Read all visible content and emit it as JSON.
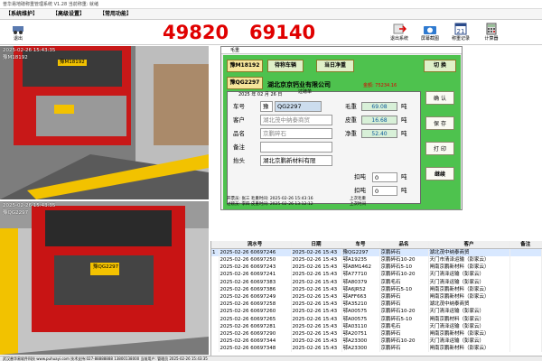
{
  "window_title": "普华易地磅称重管理系统 V1.28   当前称重: 就绪",
  "menu": [
    "系统维护",
    "高级设置",
    "常用功能"
  ],
  "toolbar": {
    "left_btn": "退出",
    "right_btns": [
      "退出系统",
      "屏幕截图",
      "称重记录",
      "计算器"
    ],
    "weight1": "49820",
    "weight2": "69140"
  },
  "camera1": {
    "timestamp": "2025-02-26  15:43:35",
    "plate_text": "豫M18192",
    "plate": "豫M18192"
  },
  "camera2": {
    "timestamp": "2025-02-26  15:43:35",
    "plate_text": "豫QG2297",
    "plate": "豫QG2297"
  },
  "dialog": {
    "title": "毛重",
    "plate_top": "豫M18192",
    "btn_queue": "待称车辆",
    "btn_today": "当日净重",
    "btn_switch": "切 换",
    "plate_bottom": "豫QG2297",
    "company": "湖北京京钙业有限公司",
    "subtitle": "过磅单",
    "date": "2025 年 02 月 26 日",
    "tabs": [
      "F1",
      "F2",
      "F3",
      "F4",
      "F5"
    ],
    "amount_label": "金额",
    "amount": "75234.16",
    "vehicle_no_label": "车号",
    "vehicle_prefix": "豫",
    "vehicle_no": "QG2297",
    "customer_label": "客户",
    "customer": "湖北茂中纳泰商贸",
    "product_label": "品名",
    "product": "京鹏碎石",
    "remark_label": "备注",
    "remark": "",
    "header_label": "抬头",
    "header": "湖北京鹏新材料有限",
    "gross_label": "毛重",
    "gross": "69.08",
    "tare_label": "皮重",
    "tare": "16.68",
    "net_label": "净重",
    "net": "52.40",
    "unit": "吨",
    "deduct_label": "扣吨",
    "deduct": "0",
    "deduct_unit": "吨",
    "deduct2_label": "扣吨",
    "deduct2": "0",
    "deduct2_unit": "吨",
    "btn_confirm": "确 认",
    "btn_save": "保 存",
    "btn_print": "打 印",
    "btn_continue": "继续",
    "foot": {
      "l1": "开票员: 张三   毛重时间: 2025-02-26 15:43:16",
      "l2": "过磅员: 李四   皮重时间: 2025-02-26 13:12:12",
      "r1": "上次毛重",
      "r2": "上次时间"
    }
  },
  "table": {
    "headers": [
      "",
      "流水号",
      "日期",
      "车号",
      "品名",
      "客户",
      "备注"
    ],
    "rows": [
      [
        "1",
        "2025-02-26 60697246",
        "2025-02-26 15:43",
        "豫QG2297",
        "京鹏碎石",
        "湖北茂中纳泰商贸",
        ""
      ],
      [
        "",
        "2025-02-26 60697250",
        "2025-02-26 15:43",
        "鄂A19235",
        "京鹏碎石10-20",
        "天门市清泽运输（彭家云）",
        ""
      ],
      [
        "",
        "2025-02-26 60697243",
        "2025-02-26 15:43",
        "鄂A8M1462",
        "京鹏碎石5-10",
        "闸南京鹏新材料（彭家云）",
        ""
      ],
      [
        "",
        "2025-02-26 60697241",
        "2025-02-26 15:43",
        "鄂A77710",
        "京鹏碎石10-20",
        "天门清泽运输（彭家云）",
        ""
      ],
      [
        "",
        "2025-02-26 60697383",
        "2025-02-26 15:43",
        "鄂A80379",
        "京鹏毛石",
        "天门清泽运输（彭家云）",
        ""
      ],
      [
        "",
        "2025-02-26 60697386",
        "2025-02-26 15:43",
        "鄂A6JR52",
        "京鹏碎石5-10",
        "闸南京鹏新材料（彭家云）",
        ""
      ],
      [
        "",
        "2025-02-26 60697249",
        "2025-02-26 15:43",
        "鄂AFF663",
        "京鹏碎石",
        "闸南京鹏新材料（彭家云）",
        ""
      ],
      [
        "",
        "2025-02-26 60697258",
        "2025-02-26 15:43",
        "鄂A35210",
        "京鹏碎石",
        "湖北茂中纳泰商贸",
        ""
      ],
      [
        "",
        "2025-02-26 60697260",
        "2025-02-26 15:43",
        "鄂A00575",
        "京鹏碎石10-20",
        "天门清泽运输（彭家云）",
        ""
      ],
      [
        "",
        "2025-02-26 60697265",
        "2025-02-26 15:43",
        "鄂A00575",
        "京鹏碎石5-10",
        "闸南京鹏材料（彭家云）",
        ""
      ],
      [
        "",
        "2025-02-26 60697281",
        "2025-02-26 15:43",
        "鄂A03110",
        "京鹏毛石",
        "天门清泽运输（彭家云）",
        ""
      ],
      [
        "",
        "2025-02-26 60697290",
        "2025-02-26 15:43",
        "鄂A20751",
        "京鹏碎石",
        "闸南京鹏新材料（彭家云）",
        ""
      ],
      [
        "",
        "2025-02-26 60697344",
        "2025-02-26 15:43",
        "鄂A23300",
        "京鹏碎石10-20",
        "天门清泽运输（彭家云）",
        ""
      ],
      [
        "",
        "2025-02-26 60697348",
        "2025-02-26 15:43",
        "鄂A23300",
        "京鹏碎石",
        "闸南京鹏新材料（彭家云）",
        ""
      ]
    ]
  },
  "status": "武汉普华易软件科技 www.puhuayi.com  技术支持:027-88888888  13800138000  当前用户: 管理员  2025-02-26 15:43:35"
}
